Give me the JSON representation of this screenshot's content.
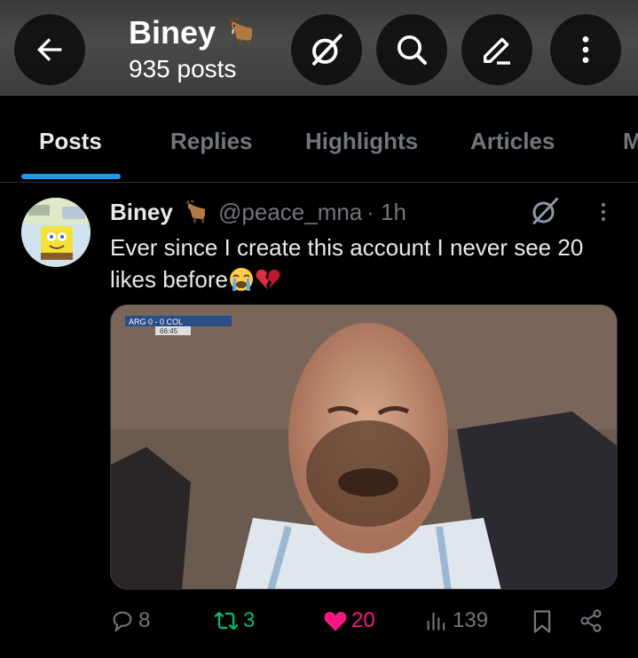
{
  "header": {
    "title": "Biney",
    "post_count": "935 posts",
    "icons": [
      "back-arrow-icon",
      "grok-icon",
      "search-icon",
      "edit-icon",
      "more-icon"
    ]
  },
  "tabs": [
    {
      "label": "Posts",
      "active": true
    },
    {
      "label": "Replies",
      "active": false
    },
    {
      "label": "Highlights",
      "active": false
    },
    {
      "label": "Articles",
      "active": false
    },
    {
      "label": "M",
      "active": false
    }
  ],
  "post": {
    "display_name": "Biney",
    "handle": "@peace_mna",
    "separator": "·",
    "time": "1h",
    "text": "Ever since I create this account I never see 20 likes before",
    "emojis": [
      "loudly-crying-face",
      "broken-heart"
    ],
    "media_scoreboard": "ARG 0 - 0 COL",
    "media_clock": "66:45",
    "actions": {
      "replies": "8",
      "reposts": "3",
      "likes": "20",
      "views": "139"
    }
  },
  "colors": {
    "accent": "#1d9bf0",
    "like": "#f91880",
    "repost": "#00ba7c",
    "muted": "#71767b",
    "text": "#e7e9ea"
  }
}
